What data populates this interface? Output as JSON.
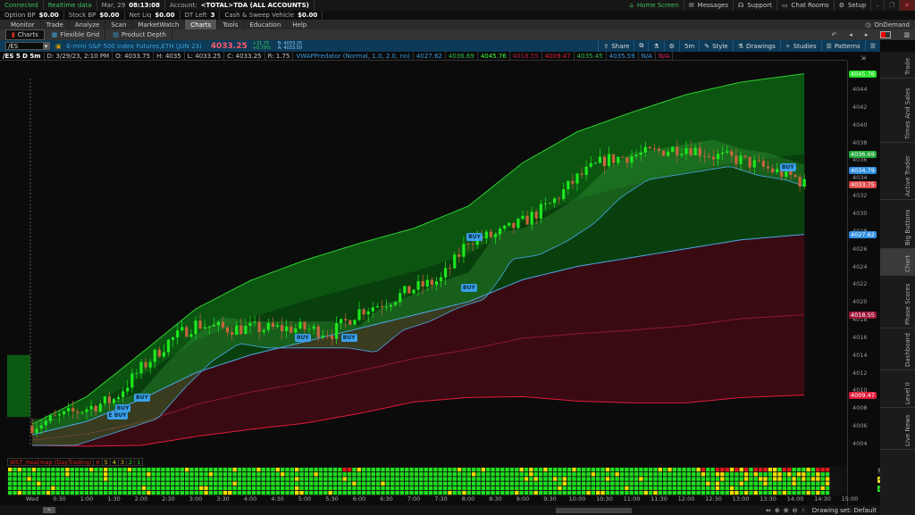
{
  "status": {
    "connected": "Connected",
    "realtime": "Realtime data",
    "date": "Mar, 29",
    "time": "08:13:08",
    "account_label": "Account:",
    "account": "<TOTAL>TDA (ALL ACCOUNTS)"
  },
  "top_right": [
    {
      "icon": "home-icon",
      "label": "Home Screen"
    },
    {
      "icon": "mail-icon",
      "label": "Messages"
    },
    {
      "icon": "headset-icon",
      "label": "Support"
    },
    {
      "icon": "chat-icon",
      "label": "Chat Rooms"
    },
    {
      "icon": "gear-icon",
      "label": "Setup"
    }
  ],
  "balances": [
    {
      "label": "Option BP",
      "value": "$0.00"
    },
    {
      "label": "Stock BP",
      "value": "$0.00"
    },
    {
      "label": "Net Liq",
      "value": "$0.00"
    },
    {
      "label": "DT Left",
      "value": "3"
    },
    {
      "label": "Cash & Sweep Vehicle",
      "value": "$0.00"
    }
  ],
  "nav_tabs": [
    "Monitor",
    "Trade",
    "Analyze",
    "Scan",
    "MarketWatch",
    "Charts",
    "Tools",
    "Education",
    "Help"
  ],
  "active_tab": "Charts",
  "ondemand": "OnDemand",
  "sub_tabs": [
    "Charts",
    "Flexible Grid",
    "Product Depth"
  ],
  "symbol": {
    "value": "/ES",
    "description": "E-mini S&P 500 Index Futures,ETH (JUN 23)",
    "last": "4033.25",
    "change": "+31.75",
    "change_pct": "+0.79%",
    "bid": "B: 4033.25",
    "ask": "A: 4033.50"
  },
  "toolbar": [
    "Share",
    "Style",
    "Drawings",
    "Studies",
    "Patterns"
  ],
  "study_row": {
    "chart_id": "/ES 5 D 5m",
    "d": "D: 3/29/23, 2:10 PM",
    "o": "O: 4033.75",
    "h": "H: 4035",
    "l": "L: 4033.25",
    "c": "C: 4033.25",
    "r": "R: 1.75",
    "study": "VWAPPredator (Normal, 1.0, 2.0, no)",
    "values": [
      {
        "v": "4027.62",
        "c": "#3a9be0"
      },
      {
        "v": "4036.69",
        "c": "#2fbf4f"
      },
      {
        "v": "4045.76",
        "c": "#3dff3d"
      },
      {
        "v": "4018.55",
        "c": "#b01c3c"
      },
      {
        "v": "4009.47",
        "c": "#e0203a"
      },
      {
        "v": "4035.45",
        "c": "#2fbf4f"
      },
      {
        "v": "4035.59",
        "c": "#3a9be0"
      },
      {
        "v": "N/A",
        "c": "#3a9be0"
      },
      {
        "v": "N/A",
        "c": "#e0207a"
      }
    ]
  },
  "price_labels": [
    {
      "v": "4045.76",
      "c": "#22e022",
      "p": 4045.76
    },
    {
      "v": "4036.69",
      "c": "#1fa83a",
      "p": 4036.69
    },
    {
      "v": "4034.79",
      "c": "#2f8fe0",
      "p": 4034.79
    },
    {
      "v": "4033.75",
      "c": "#e04848",
      "p": 4033.2
    },
    {
      "v": "4027.62",
      "c": "#2f8fe0",
      "p": 4027.62
    },
    {
      "v": "4018.55",
      "c": "#a01838",
      "p": 4018.55
    },
    {
      "v": "4009.47",
      "c": "#e01c3a",
      "p": 4009.47
    }
  ],
  "heatmap": {
    "title": "WST_Heatmap (DayTrading)",
    "levels": [
      {
        "v": "6",
        "c": "#e02020"
      },
      {
        "v": "5",
        "c": "#e0c020"
      },
      {
        "v": "4",
        "c": "#e0e020"
      },
      {
        "v": "3",
        "c": "#e0c020"
      },
      {
        "v": "2",
        "c": "#20e020"
      },
      {
        "v": "1",
        "c": "#20e020"
      }
    ],
    "axis_labels": [
      "6",
      "4",
      "2"
    ]
  },
  "right_tabs": [
    "Trade",
    "Times And Sales",
    "Active Trader",
    "Big Buttons",
    "Chart",
    "Phase Scores",
    "Dashboard",
    "Level II",
    "Live News"
  ],
  "drawing_set": "Drawing set: Default",
  "buy_signals": [
    {
      "label": "E BUY",
      "t": 1.5,
      "p": 4007.6
    },
    {
      "label": "BUY",
      "t": 1.65,
      "p": 4008.4
    },
    {
      "label": "BUY",
      "t": 2.0,
      "p": 4009.6
    },
    {
      "label": "BUY",
      "t": 4.95,
      "p": 4016.4
    },
    {
      "label": "BUY",
      "t": 5.8,
      "p": 4016.4
    },
    {
      "label": "BUY",
      "t": 8.0,
      "p": 4022.0
    },
    {
      "label": "BUY",
      "t": 8.1,
      "p": 4027.8
    },
    {
      "label": "BUY",
      "t": 13.85,
      "p": 4035.6
    }
  ],
  "colors": {
    "bull": "#1ee81e",
    "bear": "#c8643c",
    "green_band": "#0c5a12",
    "red_band": "#3a0a12",
    "vwap": "#4aa8e8"
  },
  "chart_data": {
    "type": "candlestick",
    "timeframe": "5m",
    "x_ticks": [
      "Wed",
      "0:30",
      "1:00",
      "1:30",
      "2:00",
      "2:30",
      "3:00",
      "3:30",
      "4:00",
      "4:30",
      "5:00",
      "5:30",
      "6:00",
      "6:30",
      "7:00",
      "7:30",
      "8:00",
      "8:30",
      "9:00",
      "9:30",
      "10:00",
      "10:30",
      "11:00",
      "11:30",
      "12:00",
      "12:30",
      "13:00",
      "13:30",
      "14:00",
      "14:30",
      "15:00"
    ],
    "y_ticks": [
      4004,
      4006,
      4008,
      4010,
      4012,
      4014,
      4016,
      4018,
      4020,
      4022,
      4024,
      4026,
      4028,
      4030,
      4032,
      4034,
      4036,
      4038,
      4040,
      4042,
      4044
    ],
    "ylim": [
      4002,
      4047
    ],
    "close_path": [
      [
        0,
        4006
      ],
      [
        1,
        4008
      ],
      [
        1.5,
        4009
      ],
      [
        2,
        4012.5
      ],
      [
        2.5,
        4015.5
      ],
      [
        3,
        4017.5
      ],
      [
        3.5,
        4017
      ],
      [
        4,
        4017
      ],
      [
        4.5,
        4017
      ],
      [
        5,
        4017
      ],
      [
        5.5,
        4016.5
      ],
      [
        6,
        4019
      ],
      [
        6.5,
        4020
      ],
      [
        7,
        4021.5
      ],
      [
        7.5,
        4022.5
      ],
      [
        7.8,
        4025
      ],
      [
        8,
        4027
      ],
      [
        8.5,
        4027.5
      ],
      [
        9,
        4029
      ],
      [
        9.5,
        4031
      ],
      [
        10,
        4034
      ],
      [
        10.5,
        4036
      ],
      [
        11,
        4036.5
      ],
      [
        11.5,
        4037
      ],
      [
        12,
        4037.5
      ],
      [
        12.5,
        4036.5
      ],
      [
        13,
        4036
      ],
      [
        13.5,
        4035
      ],
      [
        14,
        4034
      ],
      [
        14.17,
        4033.25
      ]
    ],
    "vwap_path": [
      [
        0,
        4005
      ],
      [
        1,
        4006.5
      ],
      [
        2,
        4009
      ],
      [
        3,
        4012
      ],
      [
        4,
        4014
      ],
      [
        5,
        4015.5
      ],
      [
        6,
        4017
      ],
      [
        7,
        4018.5
      ],
      [
        8,
        4020
      ],
      [
        9,
        4022.5
      ],
      [
        10,
        4024
      ],
      [
        11,
        4025
      ],
      [
        12,
        4026
      ],
      [
        13,
        4027
      ],
      [
        14.17,
        4027.62
      ]
    ],
    "sd_path": [
      [
        0,
        0.6
      ],
      [
        1,
        1.4
      ],
      [
        2,
        2.6
      ],
      [
        3,
        3.6
      ],
      [
        4,
        4.2
      ],
      [
        5,
        4.6
      ],
      [
        6,
        4.8
      ],
      [
        7,
        4.9
      ],
      [
        8,
        5.4
      ],
      [
        9,
        6.6
      ],
      [
        10,
        7.6
      ],
      [
        11,
        8.2
      ],
      [
        12,
        8.7
      ],
      [
        13,
        8.9
      ],
      [
        14.17,
        9.07
      ]
    ]
  }
}
